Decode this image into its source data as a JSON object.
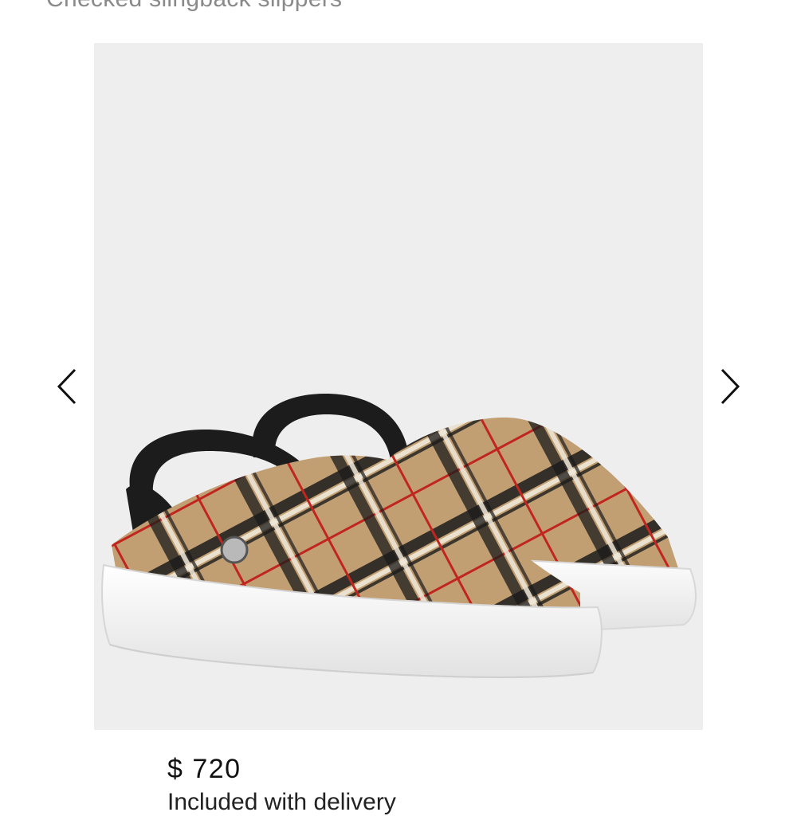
{
  "product": {
    "title": "Checked slingback slippers",
    "price": "$ 720",
    "description_cut": "Included with delivery"
  },
  "gallery": {
    "prev_icon": "chevron-left-icon",
    "next_icon": "chevron-right-icon",
    "background": "#eeeeee",
    "image_subject": "shoe-image"
  },
  "colors": {
    "check_base": "#c29f72",
    "check_black": "#1b1b1b",
    "check_red": "#c0261f",
    "check_cream": "#efe8da",
    "sole": "#ffffff",
    "strap": "#1c1c1c"
  }
}
